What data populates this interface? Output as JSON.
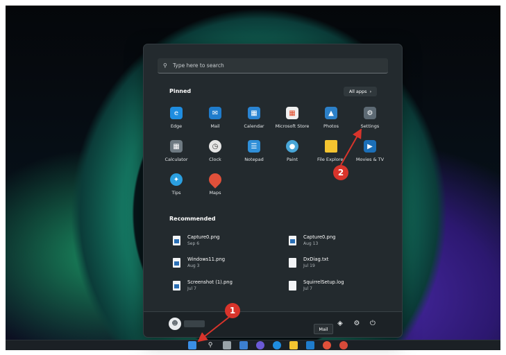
{
  "start_menu": {
    "search": {
      "placeholder": "Type here to search"
    },
    "pinned": {
      "title": "Pinned",
      "all_apps_label": "All apps",
      "apps": [
        {
          "label": "Edge",
          "icon": "edge-icon",
          "color": "#1f8de0"
        },
        {
          "label": "Mail",
          "icon": "mail-icon",
          "color": "#1f7ccc"
        },
        {
          "label": "Calendar",
          "icon": "calendar-icon",
          "color": "#2a84d2"
        },
        {
          "label": "Microsoft Store",
          "icon": "store-icon",
          "color": "#efefef"
        },
        {
          "label": "Photos",
          "icon": "photos-icon",
          "color": "#2c80c8"
        },
        {
          "label": "Settings",
          "icon": "gear-icon",
          "color": "#7b8a96"
        },
        {
          "label": "Calculator",
          "icon": "calculator-icon",
          "color": "#6e7a82"
        },
        {
          "label": "Clock",
          "icon": "clock-icon",
          "color": "#e6e6e6"
        },
        {
          "label": "Notepad",
          "icon": "notepad-icon",
          "color": "#2f8fd8"
        },
        {
          "label": "Paint",
          "icon": "paint-icon",
          "color": "#48a6d8"
        },
        {
          "label": "File Explorer",
          "icon": "folder-icon",
          "color": "#f4c430"
        },
        {
          "label": "Movies & TV",
          "icon": "movies-icon",
          "color": "#1b6fb8"
        },
        {
          "label": "Tips",
          "icon": "tips-icon",
          "color": "#2b9fe0"
        },
        {
          "label": "Maps",
          "icon": "maps-icon",
          "color": "#e0503a"
        }
      ]
    },
    "recommended": {
      "title": "Recommended",
      "items": [
        {
          "name": "Capture0.png",
          "date": "Sep 6",
          "type": "image"
        },
        {
          "name": "Capture0.png",
          "date": "Aug 13",
          "type": "image"
        },
        {
          "name": "Windows11.png",
          "date": "Aug 3",
          "type": "image"
        },
        {
          "name": "DxDiag.txt",
          "date": "Jul 19",
          "type": "text"
        },
        {
          "name": "Screenshot (1).png",
          "date": "Jul 7",
          "type": "image"
        },
        {
          "name": "SquirrelSetup.log",
          "date": "Jul 7",
          "type": "text"
        }
      ]
    },
    "footer": {
      "icons": [
        "network-icon",
        "gear-icon",
        "power-icon"
      ]
    }
  },
  "tooltip": {
    "label": "Mail"
  },
  "annotations": {
    "badge_1": "1",
    "badge_2": "2",
    "color": "#d9342b"
  },
  "taskbar": {
    "icons": [
      "windows-start-icon",
      "search-icon",
      "task-view-icon",
      "widgets-icon",
      "chat-icon",
      "edge-icon",
      "file-explorer-icon",
      "mail-icon",
      "maps-icon",
      "app-icon"
    ]
  }
}
